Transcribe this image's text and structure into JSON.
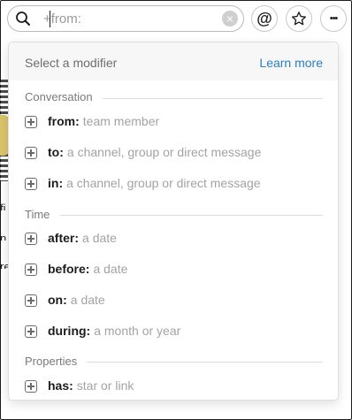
{
  "search": {
    "query": "+from:",
    "clear_label": "×"
  },
  "toolbar": {
    "mention_label": "@",
    "star_label": "☆",
    "more_label": "•••"
  },
  "background_text": [
    "fi",
    "n",
    "re"
  ],
  "dropdown": {
    "title": "Select a modifier",
    "learn_more": "Learn more",
    "sections": [
      {
        "heading": "Conversation",
        "items": [
          {
            "key": "from:",
            "hint": "team member"
          },
          {
            "key": "to:",
            "hint": "a channel, group or direct message"
          },
          {
            "key": "in:",
            "hint": "a channel, group or direct message"
          }
        ]
      },
      {
        "heading": "Time",
        "items": [
          {
            "key": "after:",
            "hint": "a date"
          },
          {
            "key": "before:",
            "hint": "a date"
          },
          {
            "key": "on:",
            "hint": "a date"
          },
          {
            "key": "during:",
            "hint": "a month or year"
          }
        ]
      },
      {
        "heading": "Properties",
        "items": [
          {
            "key": "has:",
            "hint": "star or link"
          }
        ]
      }
    ]
  },
  "colors": {
    "link": "#2a7fbd",
    "hint": "#a3a3a3",
    "section": "#7a7a7a"
  }
}
